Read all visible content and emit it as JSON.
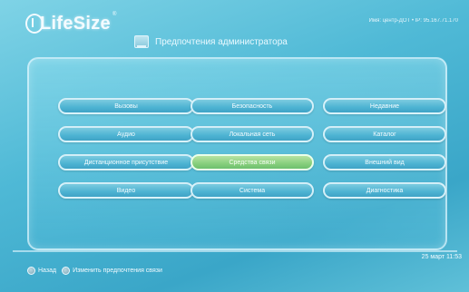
{
  "header": {
    "logo_text": "LifeSize",
    "logo_reg": "®",
    "device_info": "Имя: центр-ДОТ • IP: 95.167.71.170",
    "title": "Предпочтения администратора"
  },
  "menu": [
    [
      "Вызовы",
      "Безопасность",
      "Недавние"
    ],
    [
      "Аудио",
      "Локальная сеть",
      "Каталог"
    ],
    [
      "Дистанционное присутствие",
      "Средства связи",
      "Внешний вид"
    ],
    [
      "Видео",
      "Система",
      "Диагностика"
    ]
  ],
  "status": {
    "datetime": "25 март   11:53"
  },
  "footer": {
    "back_label": "Назад",
    "change_label": "Изменить предпочтения связи"
  },
  "colors": {
    "accent": "#4db3d2",
    "selected": "#88cf7d"
  }
}
